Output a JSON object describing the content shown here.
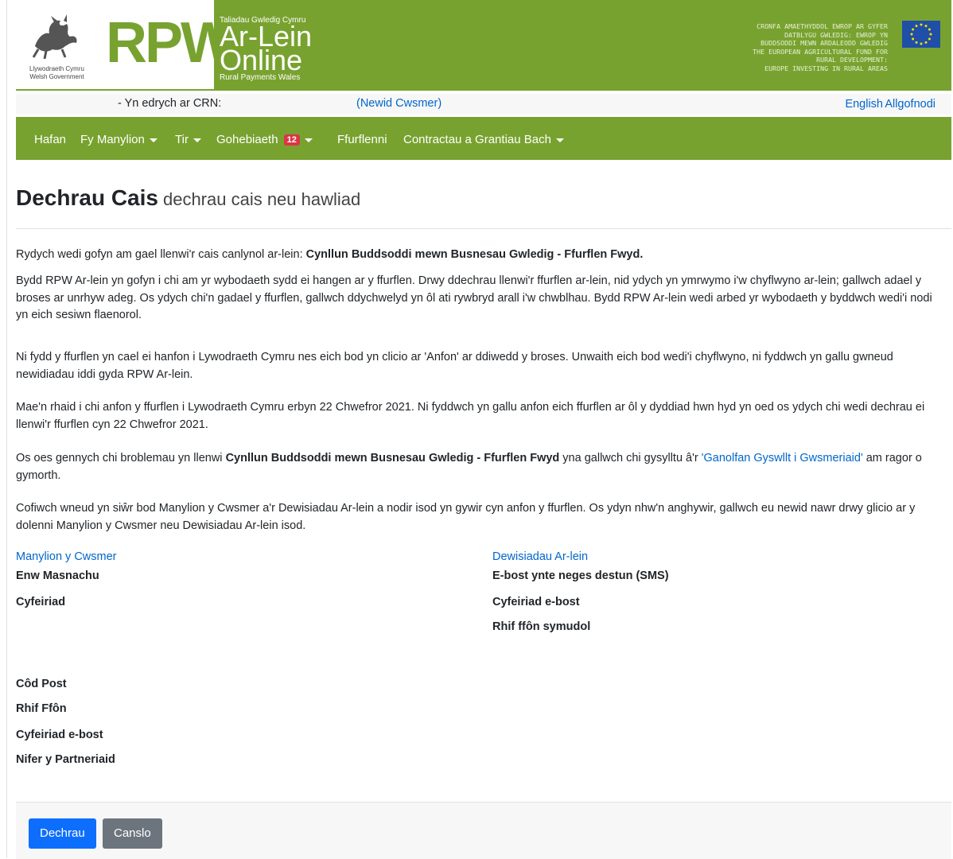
{
  "banner": {
    "gov_line1": "Llywodraeth Cymru",
    "gov_line2": "Welsh Government",
    "rpw": "RPW",
    "online_top": "Taliadau Gwledig Cymru",
    "online_line1": "Ar-Lein",
    "online_line2": "Online",
    "online_bottom": "Rural Payments Wales",
    "eu_lines": [
      "CRONFA AMAETHYDDOL EWROP AR GYFER",
      "DATBLYGU GWLEDIG: EWROP YN",
      "BUDDSODDI MEWN ARDALEODD GWLEDIG",
      "THE EUROPEAN AGRICULTURAL FUND FOR",
      "RURAL DEVELOPMENT:",
      "EUROPE INVESTING IN RURAL AREAS"
    ]
  },
  "info": {
    "crn_label": "- Yn edrych ar CRN:",
    "change_customer": "(Newid Cwsmer)",
    "english": "English",
    "logout": "Allgofnodi"
  },
  "nav": {
    "home": "Hafan",
    "my_details": "Fy Manylion",
    "land": "Tir",
    "correspondence": "Gohebiaeth",
    "correspondence_count": "12",
    "forms": "Ffurflenni",
    "contracts": "Contractau a Grantiau Bach"
  },
  "page": {
    "title": "Dechrau Cais",
    "subtitle": "dechrau cais neu hawliad"
  },
  "paragraphs": {
    "p1_pre": "Rydych wedi gofyn am gael llenwi'r cais canlynol ar-lein: ",
    "p1_bold": "Cynllun Buddsoddi mewn Busnesau Gwledig - Ffurflen Fwyd.",
    "p2": "Bydd RPW Ar-lein yn gofyn i chi am yr wybodaeth sydd ei hangen ar y ffurflen. Drwy ddechrau llenwi'r ffurflen ar-lein, nid ydych yn ymrwymo i'w chyflwyno ar-lein; gallwch adael y broses ar unrhyw adeg. Os ydych chi'n gadael y ffurflen, gallwch ddychwelyd yn ôl ati rywbryd arall i'w chwblhau. Bydd RPW Ar-lein wedi arbed yr wybodaeth y byddwch wedi'i nodi yn eich sesiwn flaenorol.",
    "p3": "Ni fydd y ffurflen yn cael ei hanfon i Lywodraeth Cymru nes eich bod yn clicio ar 'Anfon' ar ddiwedd y broses. Unwaith eich bod wedi'i chyflwyno, ni fyddwch yn gallu gwneud newidiadau iddi gyda RPW Ar-lein.",
    "p4": "Mae'n rhaid i chi anfon y ffurflen i Lywodraeth Cymru erbyn 22 Chwefror 2021. Ni fyddwch yn gallu anfon eich ffurflen ar ôl y dyddiad hwn hyd yn oed os ydych chi wedi dechrau ei llenwi'r ffurflen cyn 22 Chwefror 2021.",
    "p5_pre": "Os oes gennych chi broblemau yn llenwi ",
    "p5_bold": "Cynllun Buddsoddi mewn Busnesau Gwledig - Ffurflen Fwyd",
    "p5_mid": " yna gallwch chi gysylltu â'r ",
    "p5_link": "'Ganolfan Gyswllt i Gwsmeriaid'",
    "p5_post": " am ragor o gymorth.",
    "p6": "Cofiwch wneud yn siŵr bod Manylion y Cwsmer a'r Dewisiadau Ar-lein a nodir isod yn gywir cyn anfon y ffurflen. Os ydyn nhw'n anghywir, gallwch eu newid nawr drwy glicio ar y dolenni Manylion y Cwsmer neu Dewisiadau Ar-lein isod."
  },
  "customer": {
    "link": "Manylion y Cwsmer",
    "trading_name": "Enw Masnachu",
    "address": "Cyfeiriad",
    "postcode": "Côd Post",
    "phone": "Rhif Ffôn",
    "email": "Cyfeiriad e-bost",
    "partners": "Nifer y Partneriaid"
  },
  "online_prefs": {
    "link": "Dewisiadau Ar-lein",
    "contact_method": "E-bost ynte neges destun (SMS)",
    "email": "Cyfeiriad e-bost",
    "mobile": "Rhif ffôn symudol"
  },
  "buttons": {
    "start": "Dechrau",
    "cancel": "Canslo"
  },
  "colors": {
    "brand_green": "#78a22f",
    "link_blue": "#0066cc",
    "primary": "#0d6efd",
    "secondary": "#6c757d",
    "badge_red": "#dc3545"
  }
}
